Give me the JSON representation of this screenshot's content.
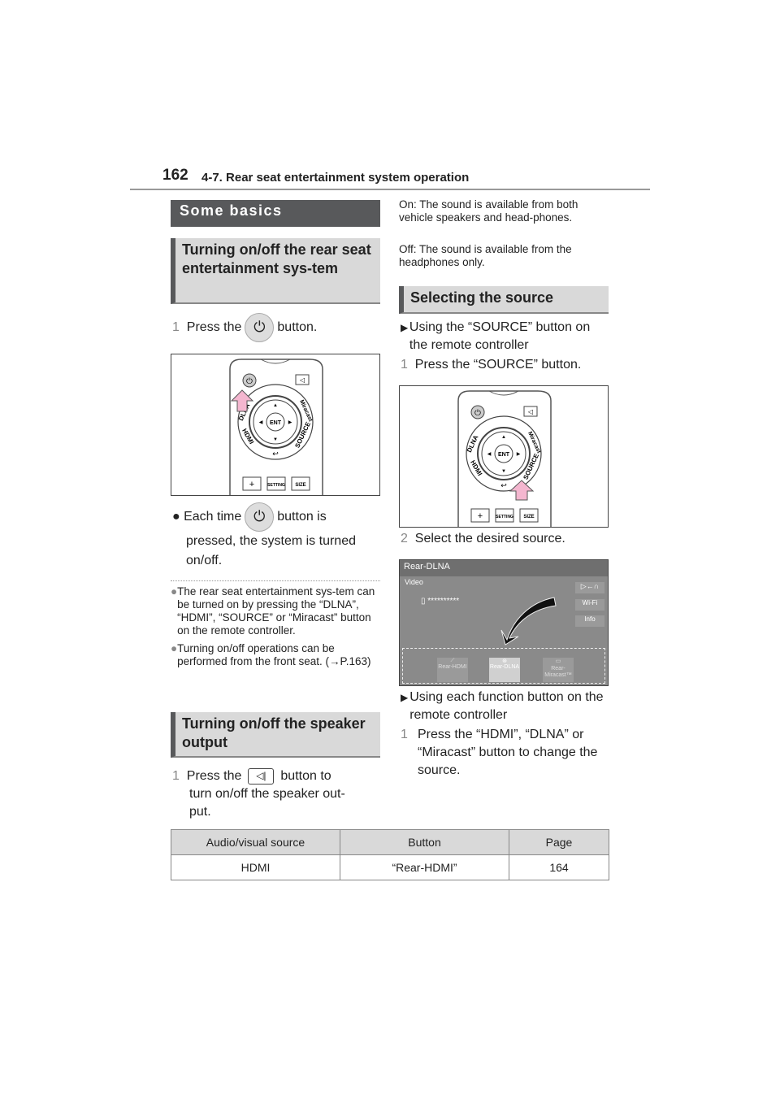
{
  "header": {
    "page_number": "162",
    "section_title": "4-7. Rear seat entertainment system operation"
  },
  "left": {
    "section_heading": "Some basics",
    "sub1": "Turning on/off the rear seat entertainment sys-tem",
    "step1_num": "1",
    "step1_pre": "Press the",
    "step1_post": "button.",
    "each_pre": "Each time",
    "each_post": "button is",
    "each_line2": "pressed, the system is turned",
    "each_line3": "on/off.",
    "notes": [
      "The rear seat entertainment sys-tem can be turned on by pressing the “DLNA”, “HDMI”, “SOURCE” or “Miracast” button on the remote controller.",
      "Turning on/off operations can be performed from the front seat. (→P.163)"
    ],
    "sub2": "Turning on/off the speaker output",
    "step2_num": "1",
    "step2_pre": "Press the",
    "step2_post": "button to",
    "step2_line2": "turn on/off the speaker out-",
    "step2_line3": "put."
  },
  "right": {
    "on_text": "On: The sound is available from both vehicle speakers and head-phones.",
    "off_text": "Off: The sound is available from the headphones only.",
    "sub": "Selecting the source",
    "bullet1": "Using the “SOURCE” button on the remote controller",
    "step1_num": "1",
    "step1": "Press the “SOURCE” button.",
    "step2_num": "2",
    "step2": "Select the desired source.",
    "bullet2": "Using each function button on the remote controller",
    "step3_num": "1",
    "step3": "Press the “HDMI”, “DLNA” or “Miracast” button to change the source."
  },
  "remote": {
    "dlna": "DLNA",
    "hdmi": "HDMI",
    "source": "SOURCE",
    "miracast": "Miracast",
    "ent": "ENT",
    "plus": "+",
    "setting": "SETTING",
    "size": "SIZE"
  },
  "screen": {
    "title": "Rear-DLNA",
    "category": "Video",
    "file": "**********",
    "btn_output": "▷←∩",
    "btn_wifi": "Wi-Fi",
    "btn_info": "Info",
    "src_hdmi": "Rear-HDMI",
    "src_dlna": "Rear-DLNA",
    "src_miracast_1": "Rear-",
    "src_miracast_2": "Miracast™"
  },
  "table": {
    "headers": [
      "Audio/visual source",
      "Button",
      "Page"
    ],
    "rows": [
      [
        "HDMI",
        "“Rear-HDMI”",
        "164"
      ]
    ]
  },
  "colors": {
    "arrow": "#f4b6cf",
    "section": "#58595b",
    "subhead": "#d9d9d9"
  }
}
